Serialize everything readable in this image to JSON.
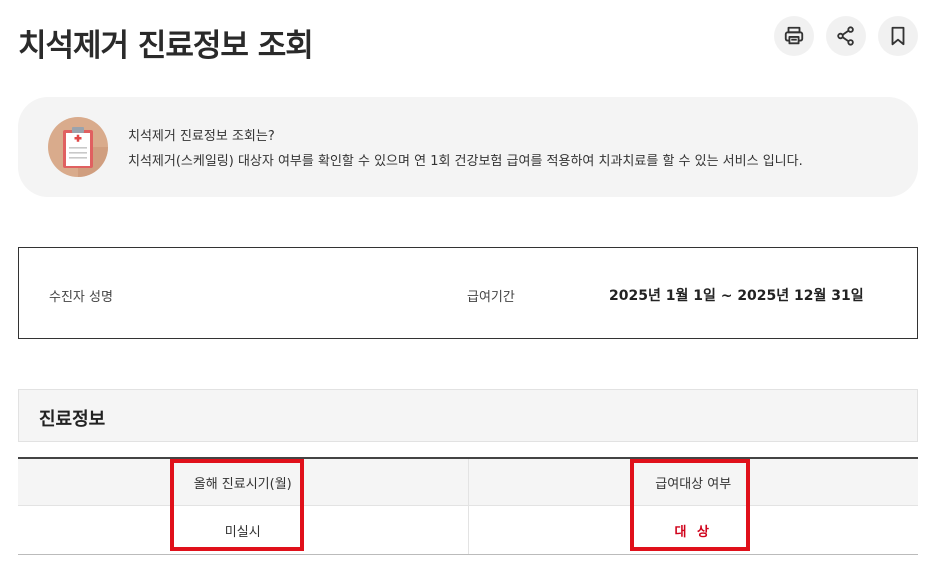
{
  "header": {
    "title": "치석제거 진료정보 조회",
    "actions": [
      {
        "icon": "printer-icon",
        "label": "print"
      },
      {
        "icon": "share-icon",
        "label": "share"
      },
      {
        "icon": "bookmark-icon",
        "label": "bookmark"
      }
    ]
  },
  "info": {
    "title": "치석제거 진료정보 조회는?",
    "description": "치석제거(스케일링) 대상자 여부를 확인할 수 있으며 연 1회 건강보험 급여를 적용하여 치과치료를 할 수 있는 서비스 입니다.",
    "icon": "medical-clipboard-icon"
  },
  "patient": {
    "name_label": "수진자 성명",
    "period_label": "급여기간",
    "period_value": "2025년 1월 1일 ~ 2025년 12월 31일"
  },
  "section": {
    "title": "진료정보"
  },
  "table": {
    "headers": [
      "올해 진료시기(월)",
      "급여대상 여부"
    ],
    "rows": [
      [
        "미실시",
        "대 상"
      ]
    ]
  },
  "colors": {
    "accent_red": "#d0021b",
    "highlight_red": "#e0101a",
    "info_bg": "#f4f4f4"
  }
}
